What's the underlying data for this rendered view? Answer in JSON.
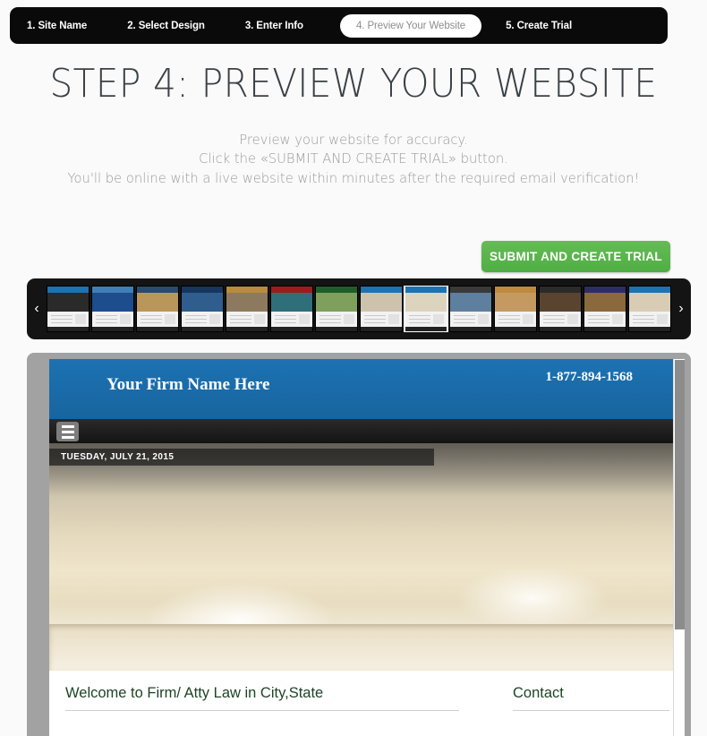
{
  "steps": [
    {
      "label": "1. Site Name",
      "active": false
    },
    {
      "label": "2. Select Design",
      "active": false
    },
    {
      "label": "3. Enter Info",
      "active": false
    },
    {
      "label": "4. Preview Your Website",
      "active": true
    },
    {
      "label": "5. Create Trial",
      "active": false
    }
  ],
  "page": {
    "title": "STEP 4: PREVIEW YOUR WEBSITE",
    "blurb_line1": "Preview your website for accuracy.",
    "blurb_line2": "Click the «SUBMIT AND CREATE TRIAL» button.",
    "blurb_line3": "You'll be online with a live website within minutes after the required email verification!"
  },
  "actions": {
    "submit_label": "SUBMIT AND CREATE TRIAL",
    "submit_color": "#55b049"
  },
  "carousel": {
    "prev_icon": "chevron-left-icon",
    "prev_glyph": "‹",
    "next_icon": "chevron-right-icon",
    "next_glyph": "›",
    "selected_index": 8,
    "thumbs": [
      {
        "bar": "#1d72b2",
        "hero": "#2a2a2a",
        "selected": false
      },
      {
        "bar": "#3f7fb5",
        "hero": "#1d4d8c",
        "selected": false
      },
      {
        "bar": "#2a4a6e",
        "hero": "#b9975b",
        "selected": false
      },
      {
        "bar": "#17365d",
        "hero": "#2f5e8e",
        "selected": false
      },
      {
        "bar": "#b98b3c",
        "hero": "#8d7a5e",
        "selected": false
      },
      {
        "bar": "#9e1b1b",
        "hero": "#2f6f7a",
        "selected": false
      },
      {
        "bar": "#1f5e2a",
        "hero": "#7ea05c",
        "selected": false
      },
      {
        "bar": "#1d72b2",
        "hero": "#cdc3ad",
        "selected": false
      },
      {
        "bar": "#1d72b2",
        "hero": "#ddd4bd",
        "selected": true
      },
      {
        "bar": "#3a3a3a",
        "hero": "#5f7f9e",
        "selected": false
      },
      {
        "bar": "#c08a3e",
        "hero": "#c49a60",
        "selected": false
      },
      {
        "bar": "#2b2b2b",
        "hero": "#5a4430",
        "selected": false
      },
      {
        "bar": "#2d2d66",
        "hero": "#8a6a3c",
        "selected": false
      },
      {
        "bar": "#1d72b2",
        "hero": "#d8cdb4",
        "selected": false
      }
    ]
  },
  "preview": {
    "firm_name": "Your Firm Name Here",
    "phone": "1-877-894-1568",
    "menu_icon": "hamburger-menu-icon",
    "date": "TUESDAY, JULY 21, 2015",
    "hero_image": "courthouse-columns-image",
    "main_heading": "Welcome to Firm/ Atty Law in City,State",
    "side_heading": "Contact",
    "header_color": "#1a6aa8",
    "heading_color": "#1d4425"
  }
}
